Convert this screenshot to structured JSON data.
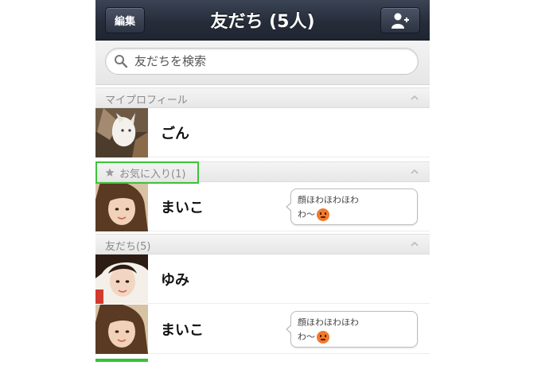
{
  "header": {
    "edit_label": "編集",
    "title": "友だち (5人)",
    "add_friend_icon": "add-friend-icon"
  },
  "search": {
    "placeholder": "友だちを検索"
  },
  "sections": {
    "my_profile": "マイプロフィール",
    "favorites": "お気に入り(1)",
    "friends": "友だち(5)"
  },
  "rows": [
    {
      "name": "ごん",
      "status": ""
    },
    {
      "name": "まいこ",
      "status_text": "顔ほわほわほわ",
      "status_text2": "わ〜"
    },
    {
      "name": "ゆみ",
      "status": ""
    },
    {
      "name": "まいこ",
      "status_text": "顔ほわほわほわ",
      "status_text2": "わ〜"
    }
  ],
  "colors": {
    "header_bg": "#262d3a",
    "highlight": "#3fc33a",
    "online": "#35c13a"
  }
}
